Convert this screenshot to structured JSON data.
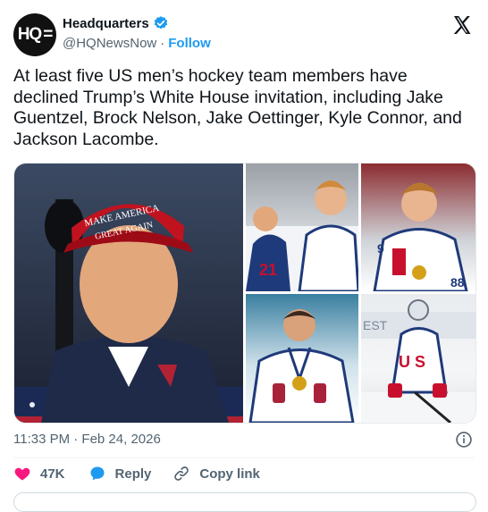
{
  "author": {
    "avatar_text": "HQ",
    "name": "Headquarters",
    "handle": "@HQNewsNow",
    "separator": "·",
    "follow_label": "Follow"
  },
  "tweet": {
    "text": "At least five US men’s hockey team members have declined Trump’s White House invitation, including Jake Guentzel, Brock Nelson, Jake Oettinger, Kyle Connor, and Jackson Lacombe.",
    "timestamp": "11:33 PM · Feb 24, 2026"
  },
  "media": {
    "photos": [
      {
        "subject": "trump-portrait",
        "hat_text": "MAKE AMERICA GREAT AGAIN"
      },
      {
        "subject": "hockey-players-celebrating"
      },
      {
        "subject": "hockey-player-smiling"
      },
      {
        "subject": "goalie-with-medal"
      },
      {
        "subject": "hockey-player-skating"
      }
    ]
  },
  "actions": {
    "likes": "47K",
    "reply_label": "Reply",
    "copy_link_label": "Copy link"
  },
  "colors": {
    "accent": "#1d9bf0",
    "like": "#f91880",
    "muted": "#536471",
    "text": "#0f1419"
  }
}
